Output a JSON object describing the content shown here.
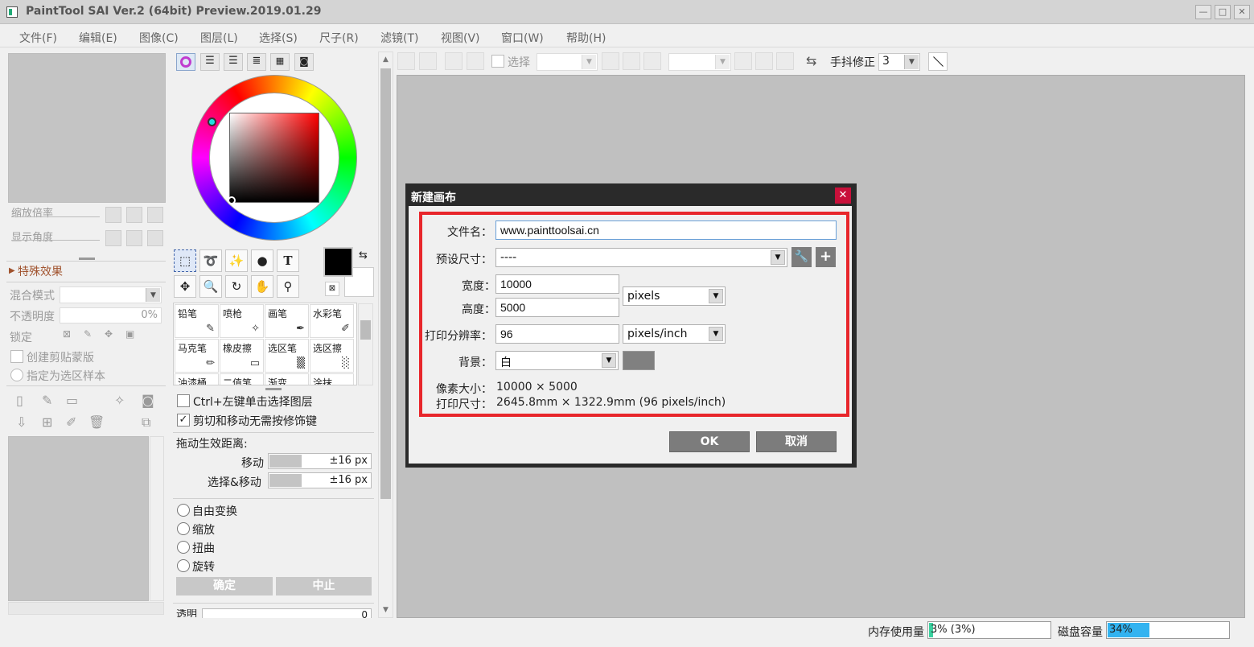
{
  "window": {
    "title": "PaintTool SAI Ver.2 (64bit) Preview.2019.01.29",
    "buttons": [
      "—",
      "□",
      "✕"
    ]
  },
  "menu": [
    "文件(F)",
    "编辑(E)",
    "图像(C)",
    "图层(L)",
    "选择(S)",
    "尺子(R)",
    "滤镜(T)",
    "视图(V)",
    "窗口(W)",
    "帮助(H)"
  ],
  "navigator": {
    "zoom_label": "缩放倍率",
    "angle_label": "显示角度"
  },
  "layer_panel": {
    "section_title": "特殊效果",
    "blend_label": "混合模式",
    "opacity_label": "不透明度",
    "opacity_value": "0%",
    "lock_label": "锁定",
    "clip_label": "创建剪贴蒙版",
    "selection_sample_label": "指定为选区样本"
  },
  "brushes": [
    {
      "name": "铅笔",
      "icon": "✎"
    },
    {
      "name": "喷枪",
      "icon": "✧"
    },
    {
      "name": "画笔",
      "icon": "✒"
    },
    {
      "name": "水彩笔",
      "icon": "✐"
    },
    {
      "name": "马克笔",
      "icon": "✏"
    },
    {
      "name": "橡皮擦",
      "icon": "▭"
    },
    {
      "name": "选区笔",
      "icon": "▒"
    },
    {
      "name": "选区擦",
      "icon": "░"
    },
    {
      "name": "油漆桶",
      "icon": ""
    },
    {
      "name": "二值笔",
      "icon": ""
    },
    {
      "name": "渐变",
      "icon": ""
    },
    {
      "name": "涂抹",
      "icon": ""
    }
  ],
  "tools": {
    "text_tool": "T"
  },
  "tool_options": {
    "ctrl_click_label": "Ctrl+左键单击选择图层",
    "ctrl_click_checked": false,
    "cut_move_label": "剪切和移动无需按修饰键",
    "cut_move_checked": true,
    "drag_distance_label": "拖动生效距离:",
    "move_label": "移动",
    "move_value": "±16 px",
    "select_move_label": "选择&移动",
    "select_move_value": "±16 px",
    "transform_options": [
      "自由变换",
      "缩放",
      "扭曲",
      "旋转"
    ],
    "confirm_label": "确定",
    "cancel_label": "中止",
    "transparency_label": "透明",
    "transparency_value": "0"
  },
  "toolbar": {
    "select_label": "选择",
    "stabilizer_label": "手抖修正",
    "stabilizer_value": "3"
  },
  "dialog": {
    "title": "新建画布",
    "close": "✕",
    "filename_label": "文件名：",
    "filename_value": "www.painttoolsai.cn",
    "preset_label": "预设尺寸：",
    "preset_value": "----",
    "width_label": "宽度：",
    "width_value": "10000",
    "height_label": "高度：",
    "height_value": "5000",
    "unit_value": "pixels",
    "resolution_label": "打印分辨率：",
    "resolution_value": "96",
    "resolution_unit": "pixels/inch",
    "background_label": "背景：",
    "background_value": "白",
    "background_color": "#808080",
    "pixel_size_label": "像素大小：",
    "pixel_size_value": "10000 × 5000",
    "print_size_label": "打印尺寸：",
    "print_size_value": "2645.8mm × 1322.9mm (96 pixels/inch)",
    "ok_label": "OK",
    "cancel_label": "取消"
  },
  "status": {
    "memory_label": "内存使用量",
    "memory_value": "3% (3%)",
    "memory_percent": 3,
    "disk_label": "磁盘容量",
    "disk_value": "34%",
    "disk_percent": 34
  },
  "colors": {
    "accent_red": "#e8262b",
    "dialog_dark": "#2a2a2a",
    "meter_memory": "#3ad1a0",
    "meter_disk": "#32b3f0"
  }
}
